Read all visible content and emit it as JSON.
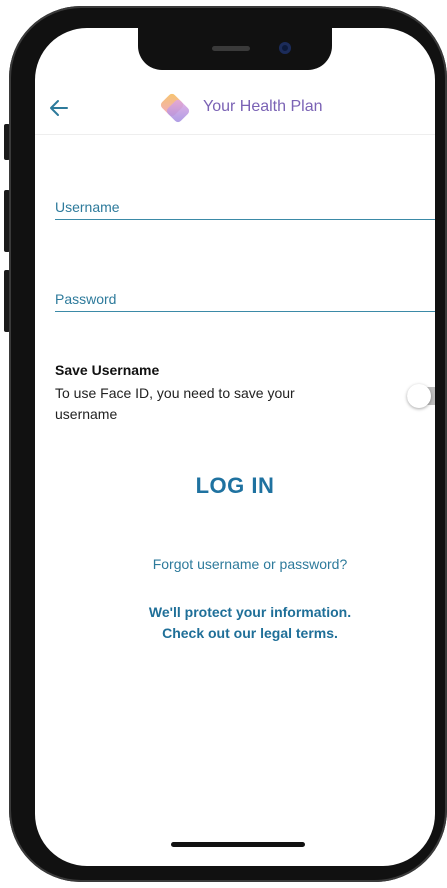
{
  "header": {
    "back_icon": "arrow-left-icon",
    "logo_icon": "health-plan-logo",
    "title": "Your Health Plan"
  },
  "form": {
    "username": {
      "label": "Username",
      "value": ""
    },
    "password": {
      "label": "Password",
      "value": ""
    }
  },
  "save_username": {
    "title": "Save Username",
    "description": "To use Face ID, you need to save your username",
    "toggle_on": false
  },
  "actions": {
    "login_label": "LOG IN",
    "forgot_label": "Forgot username or password?",
    "legal_line1": "We'll protect your information.",
    "legal_line2": "Check out our legal terms."
  },
  "colors": {
    "accent": "#2d7a9b",
    "title_purple": "#7b63b5",
    "login_blue": "#1f72a0"
  }
}
